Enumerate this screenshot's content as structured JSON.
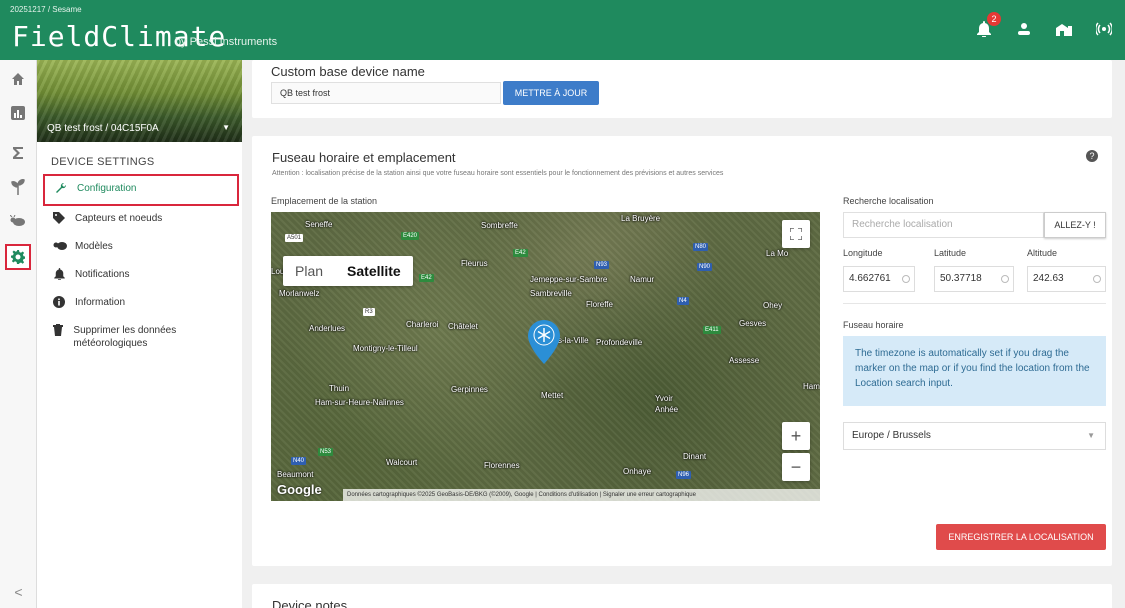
{
  "header": {
    "breadcrumb": "20251217 / Sesame",
    "logo_text": "FieldClimate",
    "logo_by": "by Pessl Instruments",
    "notification_count": "2",
    "icons": [
      "bell-icon",
      "user-icon",
      "farm-icon",
      "signal-icon"
    ]
  },
  "rail": {
    "icons": [
      "home-icon",
      "chart-icon",
      "sum-icon",
      "plant-icon",
      "pest-icon",
      "gear-icon"
    ],
    "active": "gear-icon",
    "collapse": "<"
  },
  "panel": {
    "device_name": "QB test frost / 04C15F0A",
    "title": "DEVICE SETTINGS",
    "menu": [
      {
        "label": "Configuration",
        "icon": "wrench-icon",
        "active": true
      },
      {
        "label": "Capteurs et noeuds",
        "icon": "tag-icon",
        "active": false
      },
      {
        "label": "Modèles",
        "icon": "models-icon",
        "active": false
      },
      {
        "label": "Notifications",
        "icon": "bell-icon",
        "active": false
      },
      {
        "label": "Information",
        "icon": "info-icon",
        "active": false
      },
      {
        "label": "Supprimer les données météorologiques",
        "icon": "trash-icon",
        "active": false
      }
    ]
  },
  "base_name": {
    "label": "Custom base device name",
    "value": "QB test frost",
    "button": "METTRE À JOUR"
  },
  "location": {
    "title": "Fuseau horaire et emplacement",
    "warning": "Attention : localisation précise de la station ainsi que votre fuseau horaire sont essentiels pour le fonctionnement des prévisions et autres services",
    "map_label": "Emplacement de la station",
    "map": {
      "plan": "Plan",
      "satellite": "Satellite",
      "google": "Google",
      "attribution": "Données cartographiques ©2025 GeoBasis-DE/BKG (©2009), Google | Conditions d'utilisation | Signaler une erreur cartographique",
      "zoom_in": "+",
      "zoom_out": "−",
      "places": [
        "Seneffe",
        "Sombreffe",
        "La Bruyère",
        "Fleurus",
        "Jemeppe-sur-Sambre",
        "Namur",
        "Sambreville",
        "Floreffe",
        "Charleroi",
        "Châtelet",
        "Anderlues",
        "Montigny-le-Tilleul",
        "Profondeville",
        "Gesves",
        "Assesse",
        "Thuin",
        "Gerpinnes",
        "Ham-sur-Heure-Nalinnes",
        "Mettet",
        "Yvoir",
        "Anhée",
        "Walcourt",
        "Florennes",
        "Dinant",
        "Onhaye",
        "Beaumont",
        "Ohey",
        "Morlanwelz",
        "La Mo",
        "Ham",
        "s-la-Ville",
        "Lou"
      ],
      "roads": [
        "A501",
        "E420",
        "E42",
        "N93",
        "N90",
        "N80",
        "N4",
        "E411",
        "R3",
        "N53",
        "N40",
        "N96",
        "E42"
      ]
    },
    "search_label": "Recherche localisation",
    "search_placeholder": "Recherche localisation",
    "search_button": "ALLEZ-Y !",
    "longitude_label": "Longitude",
    "latitude_label": "Latitude",
    "altitude_label": "Altitude",
    "longitude": "4.662761",
    "latitude": "50.37718",
    "altitude": "242.63",
    "timezone_label": "Fuseau horaire",
    "timezone_info": "The timezone is automatically set if you drag the marker on the map or if you find the location from the Location search input.",
    "timezone_value": "Europe / Brussels",
    "save_button": "ENREGISTRER LA LOCALISATION"
  },
  "notes": {
    "title": "Device notes"
  },
  "colors": {
    "brand": "#1f8a5e",
    "blue_button": "#3d7cc9",
    "red_button": "#e04b4b",
    "highlight": "#d9263c"
  }
}
